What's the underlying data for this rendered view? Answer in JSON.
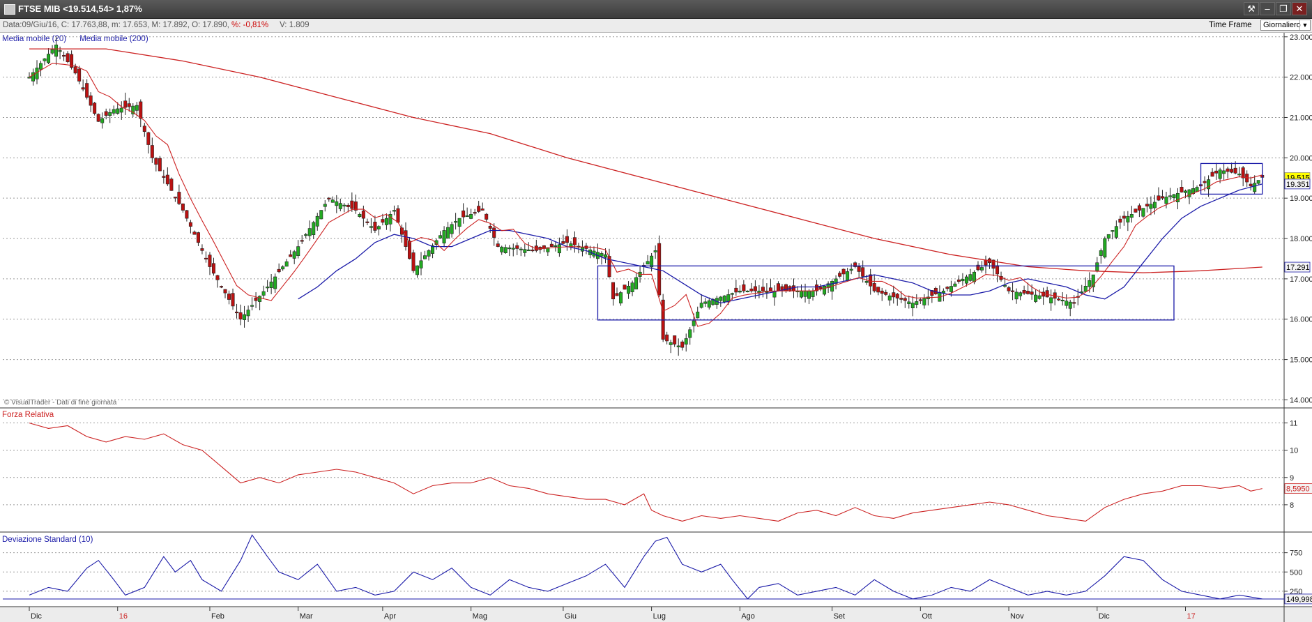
{
  "window": {
    "title": "FTSE MIB <19.514,54> 1,87%",
    "buttons": {
      "tools": "⚒",
      "minimize": "–",
      "restore": "❐",
      "close": "✕"
    }
  },
  "infobar": {
    "date": "Data:09/Giu/16",
    "close": "C: 17.763,88",
    "min": "m: 17.653,",
    "max": "M: 17.892,",
    "open": "O: 17.890,",
    "change": "%: -0,81%",
    "volume": "V: 1.809",
    "timeframe_label": "Time Frame",
    "timeframe_value": "Giornaliero"
  },
  "colors": {
    "bull": "#22aa22",
    "bear": "#bb1111",
    "ma20": "#1a1aa8",
    "ma200": "#cc2222",
    "rsi": "#cc2222",
    "stddev": "#1a1aa8",
    "box": "#1a1aa8",
    "grid": "#9a9a9a",
    "last_price_bg": "#ffff00"
  },
  "chart_data": [
    {
      "type": "candlestick",
      "title": "FTSE MIB",
      "legend": [
        "Media mobile (20)",
        "Media mobile (200)"
      ],
      "legend_colors": [
        "#1a1aa8",
        "#1a1aa8"
      ],
      "footer": "© VisualTrader - Dati di fine giornata",
      "ylim": [
        13800,
        23100
      ],
      "y_ticks": [
        14000,
        15000,
        16000,
        17000,
        18000,
        19000,
        20000,
        21000,
        22000,
        23000
      ],
      "y_tick_labels": [
        "14.000",
        "15.000",
        "16.000",
        "17.000",
        "18.000",
        "19.000",
        "20.000",
        "21.000",
        "22.000",
        "23.000"
      ],
      "x_labels": [
        "Dic",
        "16",
        "Feb",
        "Mar",
        "Apr",
        "Mag",
        "Giu",
        "Lug",
        "Ago",
        "Set",
        "Ott",
        "Nov",
        "Dic",
        "17"
      ],
      "x_label_days": [
        0,
        23,
        47,
        70,
        92,
        115,
        139,
        162,
        185,
        209,
        232,
        255,
        278,
        301
      ],
      "days_total": 332,
      "close_path": [
        [
          0,
          22000
        ],
        [
          7,
          22800
        ],
        [
          12,
          22100
        ],
        [
          18,
          20900
        ],
        [
          22,
          21200
        ],
        [
          28,
          21300
        ],
        [
          32,
          20000
        ],
        [
          40,
          18700
        ],
        [
          47,
          17300
        ],
        [
          55,
          16000
        ],
        [
          62,
          16800
        ],
        [
          70,
          17800
        ],
        [
          78,
          19000
        ],
        [
          85,
          18700
        ],
        [
          90,
          18200
        ],
        [
          95,
          18700
        ],
        [
          100,
          17200
        ],
        [
          108,
          18200
        ],
        [
          112,
          18500
        ],
        [
          118,
          18700
        ],
        [
          122,
          17800
        ],
        [
          132,
          17700
        ],
        [
          140,
          17900
        ],
        [
          150,
          17600
        ],
        [
          152,
          16500
        ],
        [
          157,
          16900
        ],
        [
          163,
          17700
        ],
        [
          165,
          15500
        ],
        [
          170,
          15300
        ],
        [
          175,
          16400
        ],
        [
          185,
          16700
        ],
        [
          195,
          16700
        ],
        [
          205,
          16700
        ],
        [
          215,
          17300
        ],
        [
          220,
          16700
        ],
        [
          230,
          16400
        ],
        [
          238,
          16700
        ],
        [
          250,
          17400
        ],
        [
          255,
          16700
        ],
        [
          262,
          16600
        ],
        [
          268,
          16500
        ],
        [
          272,
          16400
        ],
        [
          277,
          17100
        ],
        [
          280,
          18000
        ],
        [
          285,
          18500
        ],
        [
          295,
          19000
        ],
        [
          305,
          19300
        ],
        [
          310,
          19700
        ],
        [
          315,
          19600
        ],
        [
          318,
          19300
        ],
        [
          321,
          19515
        ]
      ],
      "ma20_path": [
        [
          70,
          16500
        ],
        [
          75,
          16800
        ],
        [
          80,
          17200
        ],
        [
          85,
          17500
        ],
        [
          90,
          17900
        ],
        [
          95,
          18100
        ],
        [
          100,
          18000
        ],
        [
          105,
          17800
        ],
        [
          110,
          17800
        ],
        [
          115,
          18000
        ],
        [
          120,
          18200
        ],
        [
          125,
          18200
        ],
        [
          130,
          18100
        ],
        [
          135,
          18000
        ],
        [
          140,
          17800
        ],
        [
          145,
          17700
        ],
        [
          150,
          17500
        ],
        [
          155,
          17400
        ],
        [
          160,
          17300
        ],
        [
          165,
          17200
        ],
        [
          170,
          16900
        ],
        [
          175,
          16600
        ],
        [
          180,
          16400
        ],
        [
          185,
          16500
        ],
        [
          190,
          16600
        ],
        [
          195,
          16700
        ],
        [
          200,
          16800
        ],
        [
          205,
          16800
        ],
        [
          210,
          16900
        ],
        [
          215,
          17000
        ],
        [
          220,
          17100
        ],
        [
          225,
          17000
        ],
        [
          230,
          16900
        ],
        [
          235,
          16700
        ],
        [
          240,
          16600
        ],
        [
          245,
          16600
        ],
        [
          250,
          16700
        ],
        [
          255,
          16900
        ],
        [
          260,
          17000
        ],
        [
          265,
          16900
        ],
        [
          270,
          16800
        ],
        [
          275,
          16600
        ],
        [
          280,
          16500
        ],
        [
          285,
          16800
        ],
        [
          290,
          17400
        ],
        [
          295,
          18000
        ],
        [
          300,
          18500
        ],
        [
          305,
          18800
        ],
        [
          310,
          19000
        ],
        [
          315,
          19200
        ],
        [
          321,
          19351
        ]
      ],
      "ma200_path": [
        [
          0,
          22700
        ],
        [
          20,
          22700
        ],
        [
          40,
          22400
        ],
        [
          60,
          22000
        ],
        [
          80,
          21500
        ],
        [
          100,
          21000
        ],
        [
          120,
          20600
        ],
        [
          140,
          20000
        ],
        [
          160,
          19500
        ],
        [
          180,
          19000
        ],
        [
          200,
          18500
        ],
        [
          220,
          18000
        ],
        [
          240,
          17600
        ],
        [
          260,
          17300
        ],
        [
          275,
          17200
        ],
        [
          290,
          17150
        ],
        [
          305,
          17200
        ],
        [
          321,
          17291
        ]
      ],
      "last_values": [
        {
          "label": "19.515",
          "value": 19515,
          "highlight": true
        },
        {
          "label": "19.351",
          "value": 19351,
          "highlight": false
        },
        {
          "label": "17.291",
          "value": 17291,
          "highlight": false
        }
      ],
      "annotations": [
        {
          "type": "rectangle",
          "x": [
            148,
            298
          ],
          "y": [
            15980,
            17320
          ]
        },
        {
          "type": "rectangle",
          "x": [
            305,
            321
          ],
          "y": [
            19100,
            19860
          ]
        }
      ]
    },
    {
      "type": "line",
      "title": "Forza Relativa",
      "ylim": [
        7.0,
        11.5
      ],
      "y_ticks": [
        8,
        9,
        10,
        11
      ],
      "y_tick_labels": [
        "8",
        "9",
        "10",
        "11"
      ],
      "last_label": "8,5950",
      "last_value": 8.595,
      "series": [
        {
          "name": "Forza Relativa",
          "values": [
            [
              0,
              11.0
            ],
            [
              5,
              10.8
            ],
            [
              10,
              10.9
            ],
            [
              15,
              10.5
            ],
            [
              20,
              10.3
            ],
            [
              25,
              10.5
            ],
            [
              30,
              10.4
            ],
            [
              35,
              10.6
            ],
            [
              40,
              10.2
            ],
            [
              45,
              10.0
            ],
            [
              50,
              9.4
            ],
            [
              55,
              8.8
            ],
            [
              60,
              9.0
            ],
            [
              65,
              8.8
            ],
            [
              70,
              9.1
            ],
            [
              75,
              9.2
            ],
            [
              80,
              9.3
            ],
            [
              85,
              9.2
            ],
            [
              90,
              9.0
            ],
            [
              95,
              8.8
            ],
            [
              100,
              8.4
            ],
            [
              105,
              8.7
            ],
            [
              110,
              8.8
            ],
            [
              115,
              8.8
            ],
            [
              120,
              9.0
            ],
            [
              125,
              8.7
            ],
            [
              130,
              8.6
            ],
            [
              135,
              8.4
            ],
            [
              140,
              8.3
            ],
            [
              145,
              8.2
            ],
            [
              150,
              8.2
            ],
            [
              155,
              8.0
            ],
            [
              160,
              8.4
            ],
            [
              162,
              7.8
            ],
            [
              165,
              7.6
            ],
            [
              170,
              7.4
            ],
            [
              175,
              7.6
            ],
            [
              180,
              7.5
            ],
            [
              185,
              7.6
            ],
            [
              190,
              7.5
            ],
            [
              195,
              7.4
            ],
            [
              200,
              7.7
            ],
            [
              205,
              7.8
            ],
            [
              210,
              7.6
            ],
            [
              215,
              7.9
            ],
            [
              220,
              7.6
            ],
            [
              225,
              7.5
            ],
            [
              230,
              7.7
            ],
            [
              235,
              7.8
            ],
            [
              240,
              7.9
            ],
            [
              245,
              8.0
            ],
            [
              250,
              8.1
            ],
            [
              255,
              8.0
            ],
            [
              260,
              7.8
            ],
            [
              265,
              7.6
            ],
            [
              270,
              7.5
            ],
            [
              275,
              7.4
            ],
            [
              280,
              7.9
            ],
            [
              285,
              8.2
            ],
            [
              290,
              8.4
            ],
            [
              295,
              8.5
            ],
            [
              300,
              8.7
            ],
            [
              305,
              8.7
            ],
            [
              310,
              8.6
            ],
            [
              315,
              8.7
            ],
            [
              318,
              8.5
            ],
            [
              321,
              8.595
            ]
          ]
        }
      ]
    },
    {
      "type": "line",
      "title": "Deviazione Standard (10)",
      "ylim": [
        50,
        1000
      ],
      "y_ticks": [
        250,
        500,
        750
      ],
      "y_tick_labels": [
        "250",
        "500",
        "750"
      ],
      "last_label": "149,998",
      "last_value": 149.998,
      "series": [
        {
          "name": "Deviazione Standard (10)",
          "values": [
            [
              0,
              200
            ],
            [
              5,
              300
            ],
            [
              10,
              250
            ],
            [
              15,
              550
            ],
            [
              18,
              650
            ],
            [
              22,
              400
            ],
            [
              25,
              200
            ],
            [
              30,
              300
            ],
            [
              35,
              700
            ],
            [
              38,
              500
            ],
            [
              42,
              650
            ],
            [
              45,
              400
            ],
            [
              50,
              250
            ],
            [
              55,
              650
            ],
            [
              58,
              980
            ],
            [
              62,
              700
            ],
            [
              65,
              500
            ],
            [
              70,
              400
            ],
            [
              75,
              600
            ],
            [
              80,
              250
            ],
            [
              85,
              300
            ],
            [
              90,
              200
            ],
            [
              95,
              250
            ],
            [
              100,
              500
            ],
            [
              105,
              400
            ],
            [
              110,
              550
            ],
            [
              115,
              300
            ],
            [
              120,
              200
            ],
            [
              125,
              400
            ],
            [
              130,
              300
            ],
            [
              135,
              250
            ],
            [
              140,
              350
            ],
            [
              145,
              450
            ],
            [
              150,
              600
            ],
            [
              155,
              300
            ],
            [
              160,
              700
            ],
            [
              163,
              900
            ],
            [
              166,
              950
            ],
            [
              170,
              600
            ],
            [
              175,
              500
            ],
            [
              180,
              600
            ],
            [
              183,
              400
            ],
            [
              187,
              150
            ],
            [
              190,
              300
            ],
            [
              195,
              350
            ],
            [
              200,
              200
            ],
            [
              205,
              250
            ],
            [
              210,
              300
            ],
            [
              215,
              200
            ],
            [
              220,
              400
            ],
            [
              225,
              250
            ],
            [
              230,
              150
            ],
            [
              235,
              200
            ],
            [
              240,
              300
            ],
            [
              245,
              250
            ],
            [
              250,
              400
            ],
            [
              255,
              300
            ],
            [
              260,
              200
            ],
            [
              265,
              250
            ],
            [
              270,
              200
            ],
            [
              275,
              250
            ],
            [
              280,
              450
            ],
            [
              285,
              700
            ],
            [
              290,
              650
            ],
            [
              295,
              400
            ],
            [
              300,
              250
            ],
            [
              305,
              200
            ],
            [
              310,
              150
            ],
            [
              315,
              200
            ],
            [
              321,
              150
            ]
          ]
        }
      ]
    }
  ]
}
